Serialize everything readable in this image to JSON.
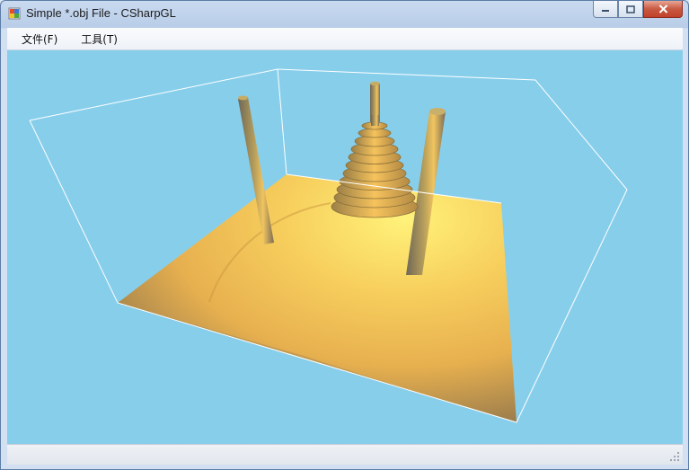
{
  "window": {
    "title": "Simple *.obj File - CSharpGL"
  },
  "menu": {
    "items": [
      "文件(F)",
      "工具(T)"
    ]
  },
  "viewport": {
    "scene": "tower-of-hanoi",
    "background_color": "#87ceeb"
  },
  "icons": {
    "app": "app-icon",
    "minimize": "minimize-icon",
    "maximize": "maximize-icon",
    "close": "close-icon",
    "grip": "resize-grip-icon"
  }
}
